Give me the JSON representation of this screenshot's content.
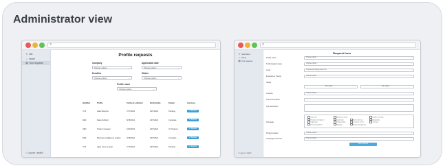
{
  "heading": "Administrator view",
  "left_window": {
    "sidebar": {
      "items": [
        {
          "icon": "list-icon",
          "label": "Lite"
        },
        {
          "icon": "home-icon",
          "label": "Home"
        },
        {
          "icon": "requests-icon",
          "label": "Your requests"
        }
      ],
      "logout": "Log out / switch"
    },
    "title": "Profile requests",
    "filters": {
      "company": {
        "label": "Company",
        "value": "Choose option..."
      },
      "application_date": {
        "label": "Application date",
        "value": "Choose option..."
      },
      "deadline": {
        "label": "Deadline",
        "value": "Choose option..."
      },
      "status": {
        "label": "Status",
        "value": "Choose option..."
      },
      "profile_name": {
        "label": "Profile name",
        "value": "Choose option..."
      }
    },
    "table": {
      "headers": [
        "Identifier",
        "Profile",
        "Fecha de solicitud",
        "Fecha límite",
        "Estado",
        "Acciones"
      ],
      "rows": [
        {
          "id": "XYZ",
          "profile": "Data Scientist",
          "applied": "7/17/2024",
          "deadline": "29/7/2024",
          "status": "Pending",
          "action": "Review"
        },
        {
          "id": "DEF",
          "profile": "Data Architect",
          "applied": "8/15/2024",
          "deadline": "29/7/2024",
          "status": "Complete",
          "action": "Review"
        },
        {
          "id": "ABC",
          "profile": "Project manager",
          "applied": "10/2/2024",
          "deadline": "29/7/2024",
          "status": "In Progress",
          "action": "Review"
        },
        {
          "id": "DEF",
          "profile": "Business intelligence analyst",
          "applied": "3/15/2024",
          "deadline": "29/7/2024",
          "status": "Complete",
          "action": "Review"
        },
        {
          "id": "XYZ",
          "profile": "Agile scrum master",
          "applied": "7/17/2024",
          "deadline": "29/7/2024",
          "status": "Pending",
          "action": "Review"
        }
      ]
    }
  },
  "right_window": {
    "sidebar": {
      "items": [
        {
          "icon": "list-icon",
          "label": "New Maria"
        },
        {
          "icon": "home-icon",
          "label": "Home"
        },
        {
          "icon": "requests-icon",
          "label": "Your requests"
        }
      ],
      "logout": "Log out / switch"
    },
    "title": "Request form",
    "fields": [
      {
        "label": "Profile name",
        "value": "Choose option..."
      },
      {
        "label": "Technological areas",
        "value": "Choose option..."
      },
      {
        "label": "Level",
        "value": "Choose technology level first"
      },
      {
        "label": "Experience (Years)",
        "value": "Choose option..."
      },
      {
        "label": "Salary",
        "value": ""
      },
      {
        "label": "Location",
        "value": "Choose option..."
      },
      {
        "label": "Title and Position",
        "value": ""
      },
      {
        "label": "Job description",
        "value": ""
      },
      {
        "label": "Soft skills",
        "value": ""
      },
      {
        "label": "Project location",
        "value": "Choose option..."
      },
      {
        "label": "Language and level",
        "value": "Choose option..."
      }
    ],
    "salary": {
      "min": "Min salary",
      "max": "Max salary"
    },
    "soft_skills": [
      "Teamwork",
      "Attention to detail",
      "Conflict resolution",
      "Emotional intelligence",
      "Leadership",
      "Active listening",
      "Adaptability",
      "Negotiation",
      "Responsibility",
      "Customer service",
      "Creativity",
      "Time management",
      "Empathy",
      "Stress management"
    ],
    "submit_label": "Send request"
  },
  "colors": {
    "accent": "#3aa0d8",
    "close": "#ea5b54",
    "minimize": "#f0b43b",
    "maximize": "#5fc455"
  }
}
